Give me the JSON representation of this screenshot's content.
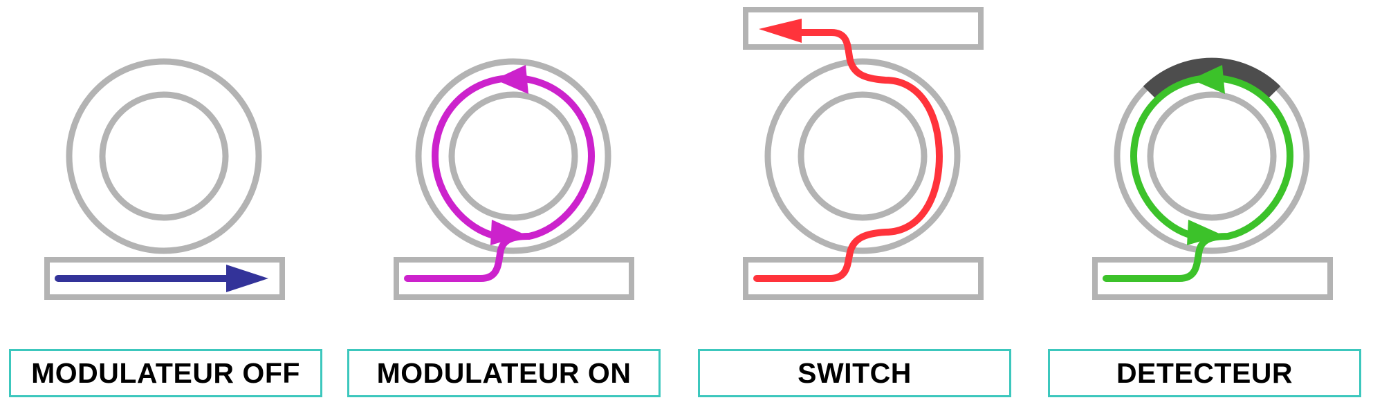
{
  "colors": {
    "device_gray": "#b3b3b3",
    "detector_dark": "#4d4d4d",
    "modulator_off": "#333399",
    "modulator_on": "#cc22cc",
    "switch": "#ff333b",
    "detector": "#3cc22a",
    "label_border": "#3cc7bd"
  },
  "panels": [
    {
      "label": "MODULATEUR OFF",
      "light_color": "#333399"
    },
    {
      "label": "MODULATEUR ON",
      "light_color": "#cc22cc"
    },
    {
      "label": "SWITCH",
      "light_color": "#ff333b"
    },
    {
      "label": "DETECTEUR",
      "light_color": "#3cc22a"
    }
  ]
}
